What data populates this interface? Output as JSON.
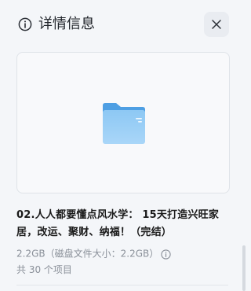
{
  "header": {
    "title": "详情信息",
    "info_icon": "info-circle-icon",
    "close_icon": "close-icon"
  },
  "preview": {
    "icon": "folder-icon",
    "accent_color": "#64aeea"
  },
  "file": {
    "name": "02.人人都要懂点风水学： 15天打造兴旺家居，改运、聚财、纳福！（完结）",
    "size_label": "2.2GB（磁盘文件大小：2.2GB）",
    "item_count_label": "共 30 个项目"
  }
}
